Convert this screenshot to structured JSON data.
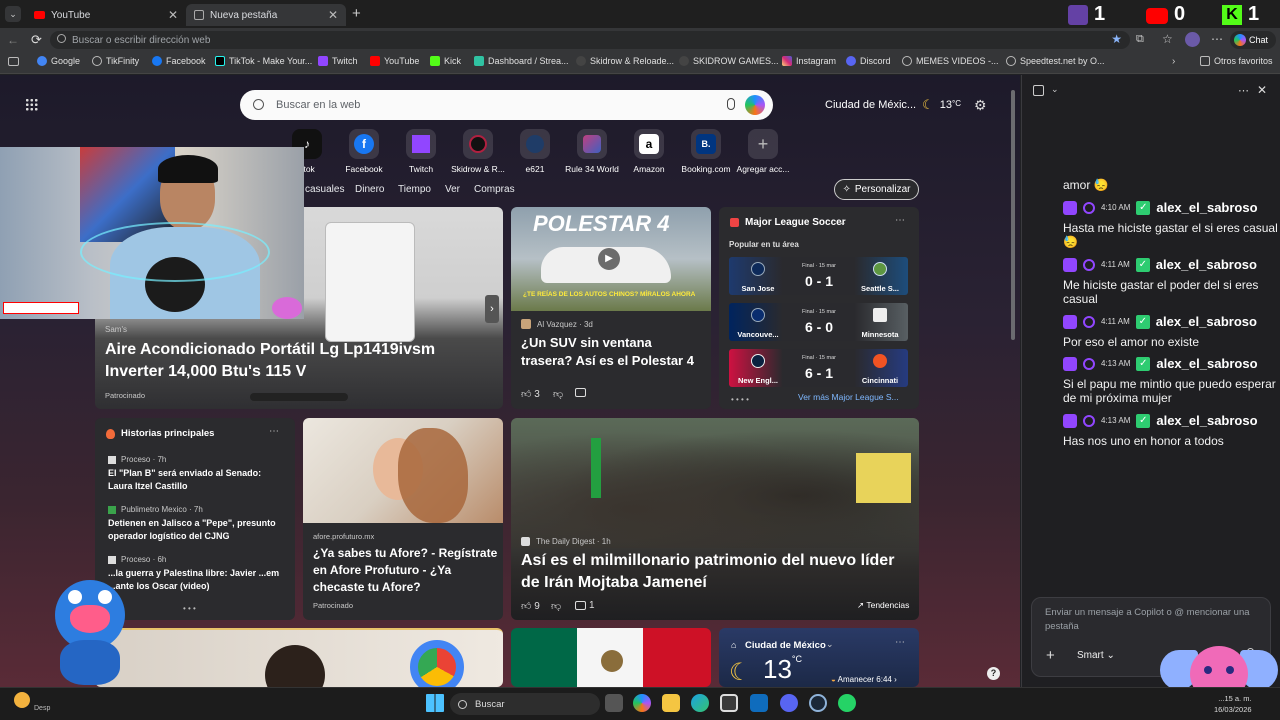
{
  "browser": {
    "tabs": [
      {
        "label": "YouTube",
        "active": false
      },
      {
        "label": "Nueva pestaña",
        "active": true
      }
    ],
    "new_tab_glyph": "+",
    "address_placeholder": "Buscar o escribir dirección web",
    "chat_button": "Chat",
    "bookmarks": [
      "Google",
      "TikFinity",
      "Facebook",
      "TikTok - Make Your...",
      "Twitch",
      "YouTube",
      "Kick",
      "Dashboard / Strea...",
      "Skidrow & Reloade...",
      "SKIDROW GAMES...",
      "Instagram",
      "Discord",
      "MEMES VIDEOS -...",
      "Speedtest.net by O..."
    ],
    "other_bookmarks": "Otros favoritos",
    "colors": {
      "accent": "#9146ff",
      "youtube": "#ff0000",
      "kick": "#53fc18"
    }
  },
  "overlay": {
    "twitch_count": "1",
    "youtube_count": "0",
    "kick_count": "1"
  },
  "ntp": {
    "search_placeholder": "Buscar en la web",
    "location": "Ciudad de Méxic...",
    "temperature": "13",
    "temp_unit": "°C",
    "tiles": [
      "ctok",
      "Facebook",
      "Twitch",
      "Skidrow & R...",
      "e621",
      "Rule 34 World",
      "Amazon",
      "Booking.com",
      "Agregar acc..."
    ],
    "nav": [
      "casuales",
      "Dinero",
      "Tiempo",
      "Ver",
      "Compras"
    ],
    "personalize": "Personalizar",
    "hero": {
      "source": "Sam's",
      "title": "Aire Acondicionado Portátil Lg Lp1419ivsm Inverter 14,000 Btu's 115 V",
      "sponsored": "Patrocinado"
    },
    "polestar": {
      "banner": "POLESTAR 4",
      "caption": "¿TE REÍAS DE LOS AUTOS CHINOS? MÍRALOS AHORA",
      "author": "Al Vazquez · 3d",
      "title": "¿Un SUV sin ventana trasera? Así es el Polestar 4",
      "likes": "3"
    },
    "soccer": {
      "league": "Major League Soccer",
      "subtitle": "Popular en tu área",
      "matches": [
        {
          "home": "San Jose",
          "away": "Seattle S...",
          "score": "0 - 1",
          "status": "Final · 15 mar"
        },
        {
          "home": "Vancouve...",
          "away": "Minnesota",
          "score": "6 - 0",
          "status": "Final · 15 mar"
        },
        {
          "home": "New Engl...",
          "away": "Cincinnati",
          "score": "6 - 1",
          "status": "Final · 15 mar"
        }
      ],
      "more": "Ver más Major League S..."
    },
    "top_stories": {
      "heading": "Historias principales",
      "items": [
        {
          "source": "Proceso · 7h",
          "title": "El \"Plan B\" será enviado al Senado: Laura Itzel Castillo"
        },
        {
          "source": "Publimetro Mexico · 7h",
          "title": "Detienen en Jalisco a \"Pepe\", presunto operador logístico del CJNG"
        },
        {
          "source": "Proceso · 6h",
          "title": "...la guerra y Palestina libre: Javier ...em ...ante los Oscar (video)"
        }
      ]
    },
    "afore": {
      "source": "afore.profuturo.mx",
      "title": "¿Ya sabes tu Afore? - Regístrate en Afore Profuturo - ¿Ya checaste tu Afore?",
      "sponsored": "Patrocinado"
    },
    "iran": {
      "source": "The Daily Digest · 1h",
      "title": "Así es el milmillonario patrimonio del nuevo líder de Irán Mojtaba Jameneí",
      "likes": "9",
      "comments": "1",
      "trending": "Tendencias"
    },
    "weather": {
      "city": "Ciudad de México",
      "temp": "13",
      "unit": "°C",
      "sunrise": "Amanecer 6:44"
    }
  },
  "copilot": {
    "chat": [
      {
        "type": "msg",
        "text": "amor 😓"
      },
      {
        "type": "user",
        "time": "4:10 AM",
        "name": "alex_el_sabroso"
      },
      {
        "type": "msg",
        "text": "Hasta me hiciste gastar el si eres casual 😓"
      },
      {
        "type": "user",
        "time": "4:11 AM",
        "name": "alex_el_sabroso"
      },
      {
        "type": "msg",
        "text": "Me hiciste gastar el poder del si eres casual"
      },
      {
        "type": "user",
        "time": "4:11 AM",
        "name": "alex_el_sabroso"
      },
      {
        "type": "msg",
        "text": "Por eso el amor no existe"
      },
      {
        "type": "user",
        "time": "4:13 AM",
        "name": "alex_el_sabroso"
      },
      {
        "type": "msg",
        "text": "Si el papu me mintio que puedo esperar de mi próxima mujer"
      },
      {
        "type": "user",
        "time": "4:13 AM",
        "name": "alex_el_sabroso"
      },
      {
        "type": "msg",
        "text": "Has nos uno en honor a todos"
      }
    ],
    "input_placeholder": "Enviar un mensaje a Copilot o @ mencionar una pestaña",
    "mode": "Smart"
  },
  "taskbar": {
    "search": "Buscar",
    "weather_short": "Desp",
    "time": "...15 a. m.",
    "date": "16/03/2026"
  }
}
